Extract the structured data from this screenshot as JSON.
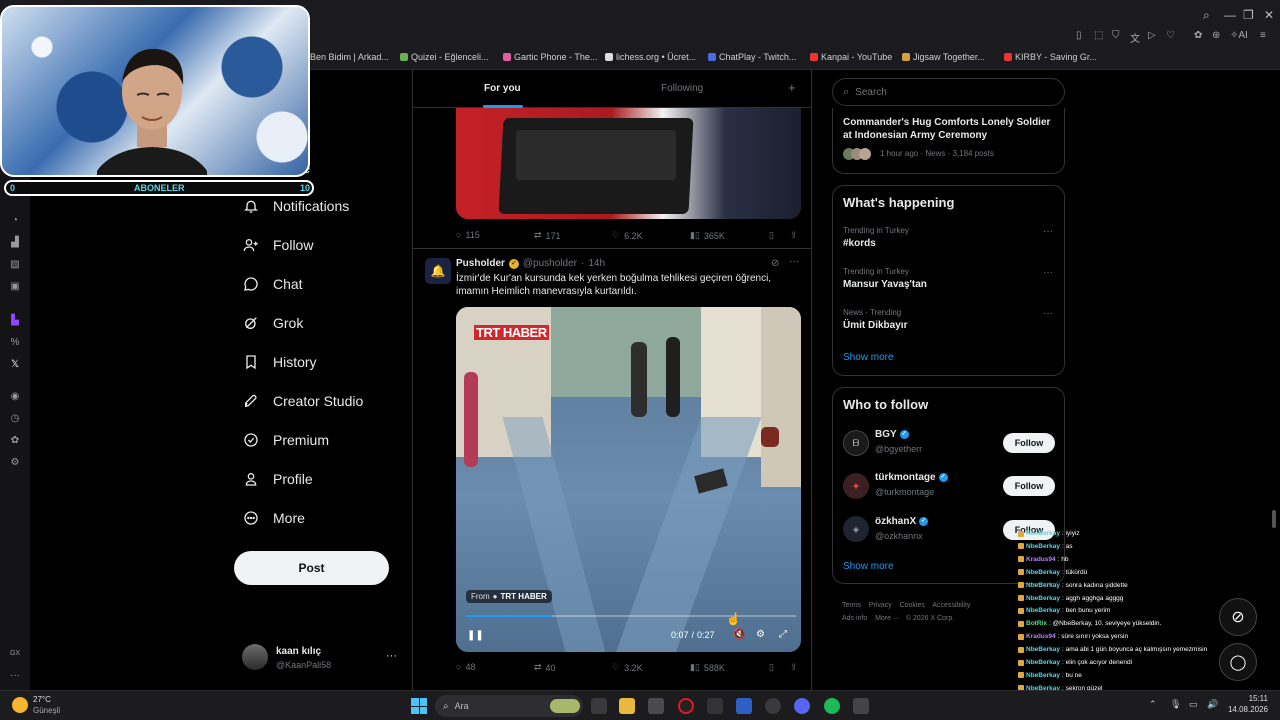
{
  "browser": {
    "bookmarks": [
      "Ben Bidim | Arkad...",
      "Quizei - Eğlenceli...",
      "Gartic Phone - The...",
      "lichess.org • Ücret...",
      "ChatPlay - Twitch...",
      "Kanpai - YouTube",
      "Jigsaw Together...",
      "KIRBY - Saving Gr..."
    ],
    "ai_label": "AI"
  },
  "webcam": {
    "sub_min": "0",
    "sub_label": "ABONELER",
    "sub_max": "10",
    "sub_progress": 0.0
  },
  "nav": {
    "more_partial": "ore",
    "items": [
      {
        "label": "Notifications",
        "icon": "bell-icon"
      },
      {
        "label": "Follow",
        "icon": "person-add-icon"
      },
      {
        "label": "Chat",
        "icon": "chat-icon"
      },
      {
        "label": "Grok",
        "icon": "grok-icon"
      },
      {
        "label": "History",
        "icon": "bookmark-icon"
      },
      {
        "label": "Creator Studio",
        "icon": "rocket-icon"
      },
      {
        "label": "Premium",
        "icon": "verified-icon"
      },
      {
        "label": "Profile",
        "icon": "person-icon"
      },
      {
        "label": "More",
        "icon": "more-circle-icon"
      }
    ],
    "post_label": "Post",
    "account": {
      "name": "kaan kılıç",
      "handle": "@KaanPali58",
      "more": "···"
    }
  },
  "feed": {
    "tabs": [
      "For you",
      "Following"
    ],
    "add": "+",
    "tweet1_actions": {
      "replies": "115",
      "reposts": "171",
      "likes": "6.2K",
      "views": "365K"
    },
    "tweet2": {
      "author": "Pusholder",
      "handle": "@pusholder",
      "time": "14h",
      "text": "İzmir'de Kur'an kursunda kek yerken boğulma tehlikesi geçiren öğrenci, imamın Heimlich manevrasıyla kurtarıldı.",
      "video_logo": "TRT HABER",
      "from_label": "From",
      "from_source": "TRT HABER",
      "time_current": "0:07",
      "time_total": "0:27",
      "time_sep": "/",
      "progress": 0.26,
      "actions": {
        "replies": "48",
        "reposts": "40",
        "likes": "3.2K",
        "views": "588K"
      }
    }
  },
  "right": {
    "search_placeholder": "Search",
    "headline": {
      "title": "Commander's Hug Comforts Lonely Soldier at Indonesian Army Ceremony",
      "meta": "1 hour ago · News · 3,184 posts"
    },
    "happening": {
      "title": "What's happening",
      "items": [
        {
          "context": "Trending in Turkey",
          "topic": "#kords"
        },
        {
          "context": "Trending in Turkey",
          "topic": "Mansur Yavaş'tan"
        },
        {
          "context": "News · Trending",
          "topic": "Ümit Dikbayır"
        }
      ],
      "show_more": "Show more"
    },
    "who_to_follow": {
      "title": "Who to follow",
      "accounts": [
        {
          "name": "BGY",
          "handle": "@bgyetherr"
        },
        {
          "name": "türkmontage",
          "handle": "@turkmontage"
        },
        {
          "name": "özkhanX",
          "handle": "@ozkhannx"
        }
      ],
      "follow_label": "Follow",
      "show_more": "Show more"
    },
    "footer": [
      "Terms",
      "Privacy",
      "Cookies",
      "Accessibility",
      "Ads info",
      "More ···",
      "© 2026 X Corp."
    ]
  },
  "chat": [
    {
      "user": "NbeBerkay",
      "msg": ": iyiyiz",
      "color": "#5bd2e6"
    },
    {
      "user": "NbeBerkay",
      "msg": ": as",
      "color": "#5bd2e6"
    },
    {
      "user": "Kradus94",
      "msg": ": hb",
      "color": "#b483f5"
    },
    {
      "user": "NbeBerkay",
      "msg": ": tükürdü",
      "color": "#5bd2e6"
    },
    {
      "user": "NbeBerkay",
      "msg": ": sonra kadına şiddette",
      "color": "#5bd2e6"
    },
    {
      "user": "NbeBerkay",
      "msg": ": aggh agghga agggg",
      "color": "#5bd2e6"
    },
    {
      "user": "NbeBerkay",
      "msg": ": ben bunu yerim",
      "color": "#5bd2e6"
    },
    {
      "user": "BotRix",
      "msg": ": @NbeBerkay, 10. seviyeye yükseldin.",
      "color": "#4ee08a"
    },
    {
      "user": "Kradus94",
      "msg": ": süre sınırı yoksa yersin",
      "color": "#b483f5"
    },
    {
      "user": "NbeBerkay",
      "msg": ": ama abi 1 gün boyunca aç kalmışsın yemezmisin",
      "color": "#5bd2e6"
    },
    {
      "user": "NbeBerkay",
      "msg": ": elin çok acıyor denendi",
      "color": "#5bd2e6"
    },
    {
      "user": "NbeBerkay",
      "msg": ": bu ne",
      "color": "#5bd2e6"
    },
    {
      "user": "NbeBerkay",
      "msg": ": sekron güzel",
      "color": "#5bd2e6"
    },
    {
      "user": "Elofumbenr",
      "msg": ": 👀 👀",
      "color": "#b483f5"
    },
    {
      "user": "NbeBerkay",
      "msg": ": 👀",
      "color": "#5bd2e6"
    }
  ],
  "taskbar": {
    "weather_temp": "27°C",
    "weather_desc": "Güneşli",
    "search": "Ara",
    "time": "15:11",
    "date": "14.08.2026"
  },
  "colors": {
    "accent": "#1d9bf0",
    "bg": "#000000",
    "border": "#2f3336"
  }
}
